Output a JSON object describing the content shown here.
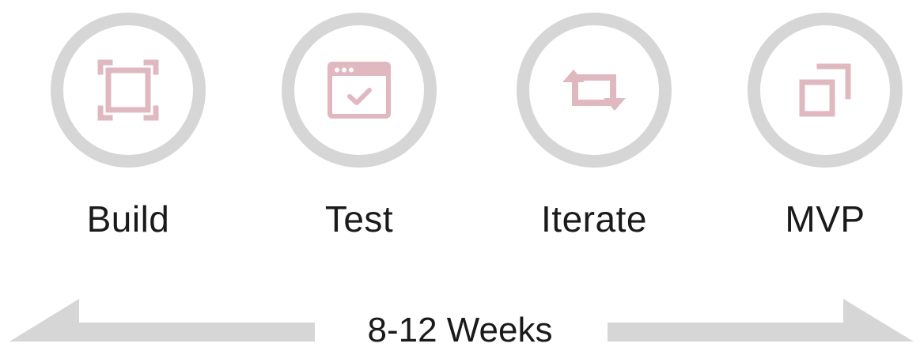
{
  "steps": [
    {
      "label": "Build",
      "icon": "frame-corners-icon"
    },
    {
      "label": "Test",
      "icon": "browser-check-icon"
    },
    {
      "label": "Iterate",
      "icon": "repeat-arrows-icon"
    },
    {
      "label": "MVP",
      "icon": "open-window-icon"
    }
  ],
  "timeline": {
    "label": "8-12 Weeks"
  },
  "colors": {
    "ring": "#d6d6d6",
    "icon": "#e0b8c0",
    "arrow": "#d6d6d6",
    "text": "#1a1a1a"
  }
}
